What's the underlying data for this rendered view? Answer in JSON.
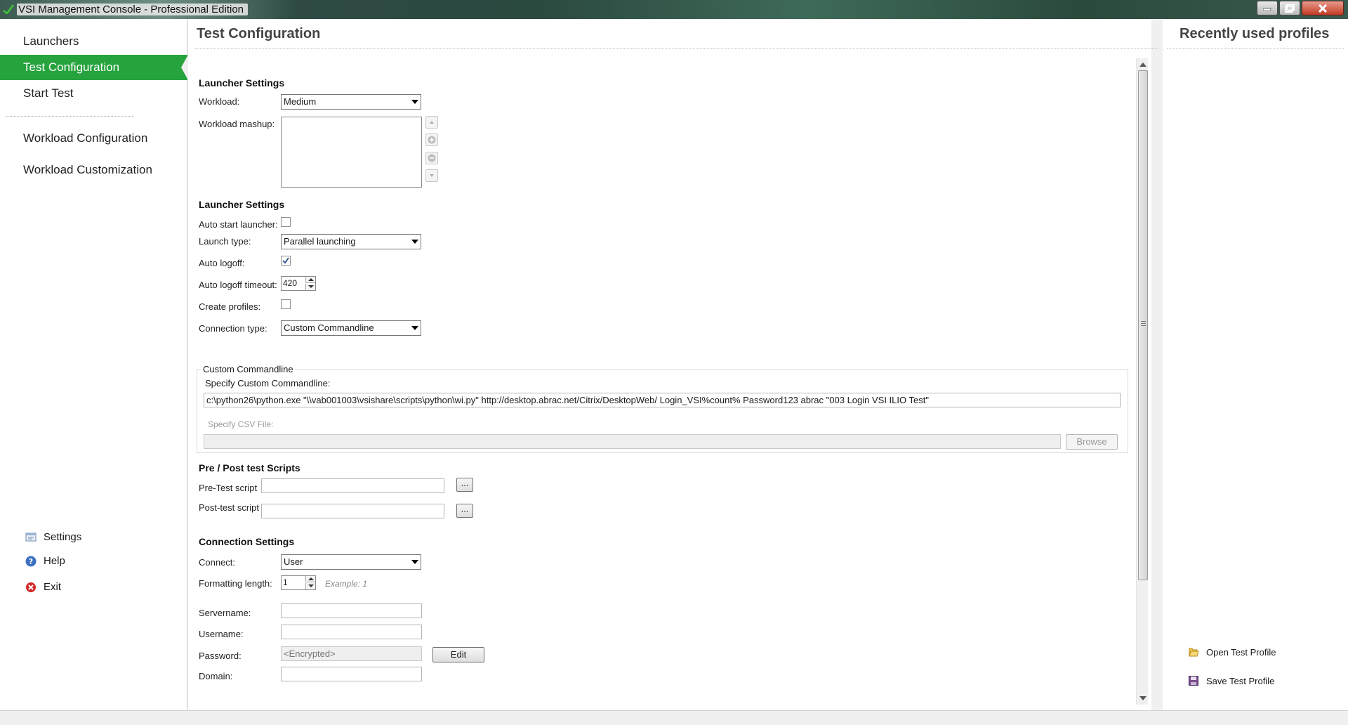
{
  "window": {
    "title": "VSI Management Console - Professional Edition"
  },
  "nav": {
    "items": [
      {
        "label": "Launchers"
      },
      {
        "label": "Test Configuration"
      },
      {
        "label": "Start Test"
      },
      {
        "label": "Workload Configuration"
      },
      {
        "label": "Workload Customization"
      }
    ],
    "bottom": [
      {
        "label": "Settings",
        "icon": "settings-icon"
      },
      {
        "label": "Help",
        "icon": "help-icon"
      },
      {
        "label": "Exit",
        "icon": "exit-icon"
      }
    ]
  },
  "main": {
    "title": "Test Configuration",
    "launcher_settings_1": {
      "heading": "Launcher Settings",
      "workload_label": "Workload:",
      "workload_value": "Medium",
      "mashup_label": "Workload mashup:"
    },
    "launcher_settings_2": {
      "heading": "Launcher Settings",
      "auto_start_label": "Auto start launcher:",
      "auto_start_checked": false,
      "launch_type_label": "Launch type:",
      "launch_type_value": "Parallel launching",
      "auto_logoff_label": "Auto logoff:",
      "auto_logoff_checked": true,
      "auto_logoff_timeout_label": "Auto logoff timeout:",
      "auto_logoff_timeout_value": "420",
      "create_profiles_label": "Create profiles:",
      "create_profiles_checked": false,
      "connection_type_label": "Connection type:",
      "connection_type_value": "Custom Commandline"
    },
    "custom_commandline": {
      "group_label": "Custom Commandline",
      "specify_label": "Specify Custom Commandline:",
      "commandline_value": "c:\\python26\\python.exe \"\\\\vab001003\\vsishare\\scripts\\python\\wi.py\" http://desktop.abrac.net/Citrix/DesktopWeb/ Login_VSI%count% Password123 abrac \"003 Login VSI ILIO Test\"",
      "csv_label": "Specify CSV File:",
      "csv_value": "",
      "browse_label": "Browse"
    },
    "scripts": {
      "heading": "Pre / Post test Scripts",
      "pre_label": "Pre-Test script",
      "pre_value": "",
      "post_label": "Post-test script",
      "post_value": "",
      "browse_button": "..."
    },
    "connection": {
      "heading": "Connection Settings",
      "connect_label": "Connect:",
      "connect_value": "User",
      "formatting_label": "Formatting length:",
      "formatting_value": "1",
      "formatting_example": "Example: 1",
      "servername_label": "Servername:",
      "servername_value": "",
      "username_label": "Username:",
      "username_value": "",
      "password_label": "Password:",
      "password_value": "<Encrypted>",
      "edit_label": "Edit",
      "domain_label": "Domain:",
      "domain_value": ""
    }
  },
  "right": {
    "title": "Recently used profiles",
    "open_label": "Open Test Profile",
    "save_label": "Save Test Profile"
  },
  "colors": {
    "accent": "#27a33e"
  }
}
